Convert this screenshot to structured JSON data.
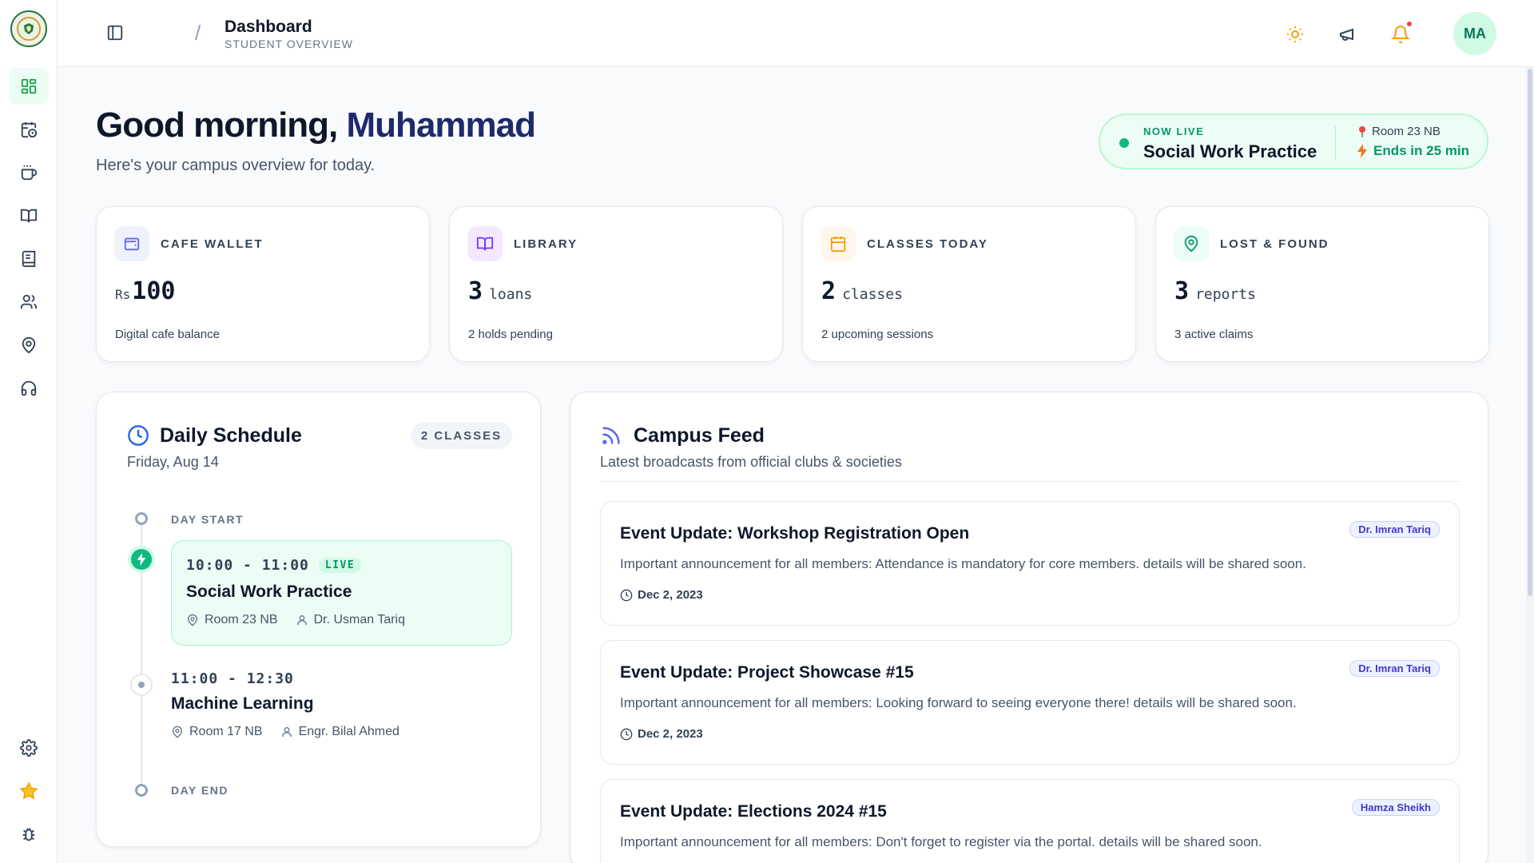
{
  "topbar": {
    "title": "Dashboard",
    "subtitle": "STUDENT OVERVIEW",
    "avatar_initials": "MA"
  },
  "greeting": {
    "prefix": "Good morning,",
    "name": "Muhammad",
    "subtitle": "Here's your campus overview for today."
  },
  "now_live": {
    "label": "NOW LIVE",
    "course": "Social Work Practice",
    "room": "Room 23 NB",
    "ends": "Ends in 25 min"
  },
  "stats": [
    {
      "label": "CAFE WALLET",
      "prefix": "Rs",
      "value": "100",
      "unit": "",
      "desc": "Digital cafe balance",
      "icon": "wallet-icon"
    },
    {
      "label": "LIBRARY",
      "prefix": "",
      "value": "3",
      "unit": "loans",
      "desc": "2 holds pending",
      "icon": "book-open-icon"
    },
    {
      "label": "CLASSES TODAY",
      "prefix": "",
      "value": "2",
      "unit": "classes",
      "desc": "2 upcoming sessions",
      "icon": "calendar-icon"
    },
    {
      "label": "LOST & FOUND",
      "prefix": "",
      "value": "3",
      "unit": "reports",
      "desc": "3 active claims",
      "icon": "map-pin-icon"
    }
  ],
  "schedule": {
    "title": "Daily Schedule",
    "date": "Friday, Aug 14",
    "badge": "2 CLASSES",
    "day_start": "DAY START",
    "day_end": "DAY END",
    "classes": [
      {
        "time": "10:00 - 11:00",
        "live_tag": "LIVE",
        "name": "Social Work Practice",
        "room": "Room 23 NB",
        "instructor": "Dr. Usman Tariq"
      },
      {
        "time": "11:00 - 12:30",
        "name": "Machine Learning",
        "room": "Room 17 NB",
        "instructor": "Engr. Bilal Ahmed"
      }
    ]
  },
  "feed": {
    "title": "Campus Feed",
    "subtitle": "Latest broadcasts from official clubs & societies",
    "posts": [
      {
        "title": "Event Update: Workshop Registration Open",
        "author": "Dr. Imran Tariq",
        "body": "Important announcement for all members: Attendance is mandatory for core members. details will be shared soon.",
        "date": "Dec 2, 2023"
      },
      {
        "title": "Event Update: Project Showcase #15",
        "author": "Dr. Imran Tariq",
        "body": "Important announcement for all members: Looking forward to seeing everyone there! details will be shared soon.",
        "date": "Dec 2, 2023"
      },
      {
        "title": "Event Update: Elections 2024 #15",
        "author": "Hamza Sheikh",
        "body": "Important announcement for all members: Don't forget to register via the portal. details will be shared soon.",
        "date": ""
      }
    ]
  },
  "colors": {
    "accent": "#10b981",
    "brand_navy": "#1e2a6b",
    "warning": "#f59e0b",
    "alert": "#ef4444"
  }
}
